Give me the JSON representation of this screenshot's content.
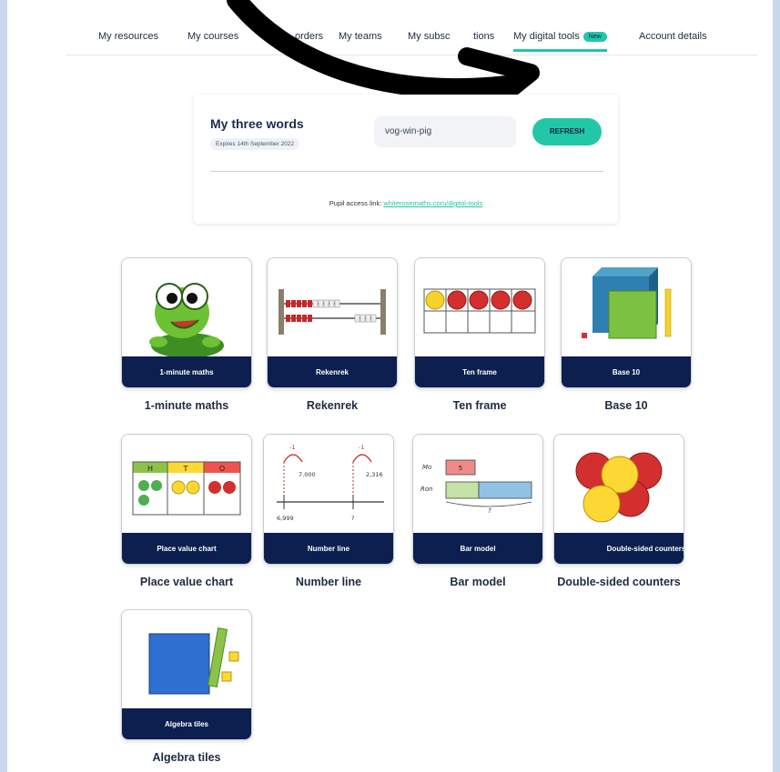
{
  "nav": {
    "items": [
      "My resources",
      "My courses",
      "orders",
      "My teams",
      "My subsc",
      "tions",
      "My digital tools",
      "Account details"
    ],
    "badge": "New"
  },
  "words_card": {
    "title": "My three words",
    "expiry": "Expires 14th September 2022",
    "words": "vog-win-pig",
    "refresh_label": "REFRESH",
    "access_prefix": "Pupil access link:",
    "access_link": "whiterosemaths.com/digital-tools"
  },
  "tools": [
    {
      "band": "1-minute maths",
      "label": "1-minute maths",
      "icon": "turtle-icon"
    },
    {
      "band": "Rekenrek",
      "label": "Rekenrek",
      "icon": "rekenrek-icon"
    },
    {
      "band": "Ten frame",
      "label": "Ten frame",
      "icon": "ten-frame-icon"
    },
    {
      "band": "Base 10",
      "label": "Base 10",
      "icon": "base-ten-blocks-icon"
    },
    {
      "band": "Place value chart",
      "label": "Place value chart",
      "icon": "place-value-chart-icon"
    },
    {
      "band": "Number line",
      "label": "Number line",
      "icon": "number-line-icon"
    },
    {
      "band": "Bar model",
      "label": "Bar model",
      "icon": "bar-model-icon"
    },
    {
      "band": "Double-sided counters",
      "label": "Double-sided counters",
      "icon": "counters-icon"
    },
    {
      "band": "Algebra tiles",
      "label": "Algebra tiles",
      "icon": "algebra-tiles-icon"
    }
  ],
  "illustrations": {
    "place_value_headers": [
      "H",
      "T",
      "O"
    ],
    "number_line_values": [
      "-1",
      "-1",
      "7,000",
      "2,316",
      "6,999",
      "?"
    ],
    "bar_model_labels": [
      "Mo",
      "5",
      "Ron",
      "?"
    ]
  },
  "colors": {
    "accent": "#22c7a7",
    "band": "#0d1f4f",
    "background": "#c9d8ef"
  }
}
